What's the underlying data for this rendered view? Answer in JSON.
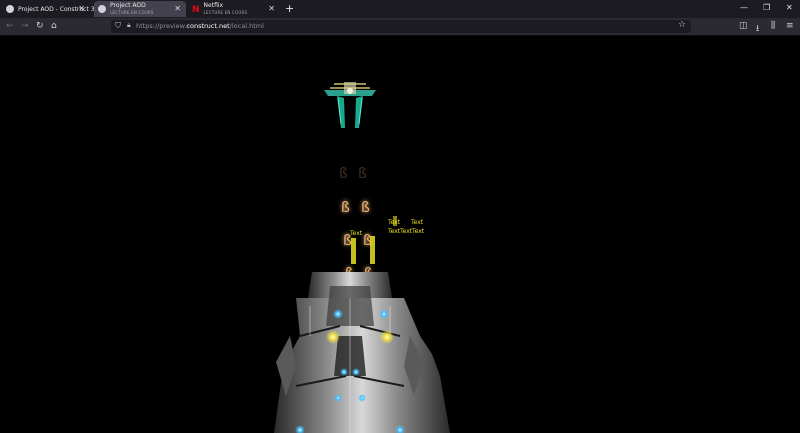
{
  "tabs": [
    {
      "title": "Project AOD - Construct 3",
      "subtitle": "",
      "active": false
    },
    {
      "title": "Project AOD",
      "subtitle": "LECTURE EN COURS",
      "active": true
    },
    {
      "title": "Netflix",
      "subtitle": "LECTURE EN COURS",
      "active": false
    }
  ],
  "window": {
    "new_tab": "+",
    "minimize": "—",
    "restore": "❐",
    "close": "✕"
  },
  "nav": {
    "back": "←",
    "forward": "→",
    "reload": "↻",
    "home": "⌂",
    "pocket": "◫",
    "download": "⭳",
    "library": "⫼",
    "menu": "≡"
  },
  "address": {
    "scheme": "https://preview.",
    "domain": "construct.net",
    "path": "/local.html",
    "star": "☆"
  },
  "game": {
    "labels": [
      "Text",
      "Text",
      "Text",
      "Text",
      "Text",
      "Text"
    ],
    "colors": {
      "text_yellow": "#e8e020",
      "orb": "#f0b070",
      "ship_teal": "#36c8b0",
      "boss_light": "#40c0ff"
    }
  }
}
